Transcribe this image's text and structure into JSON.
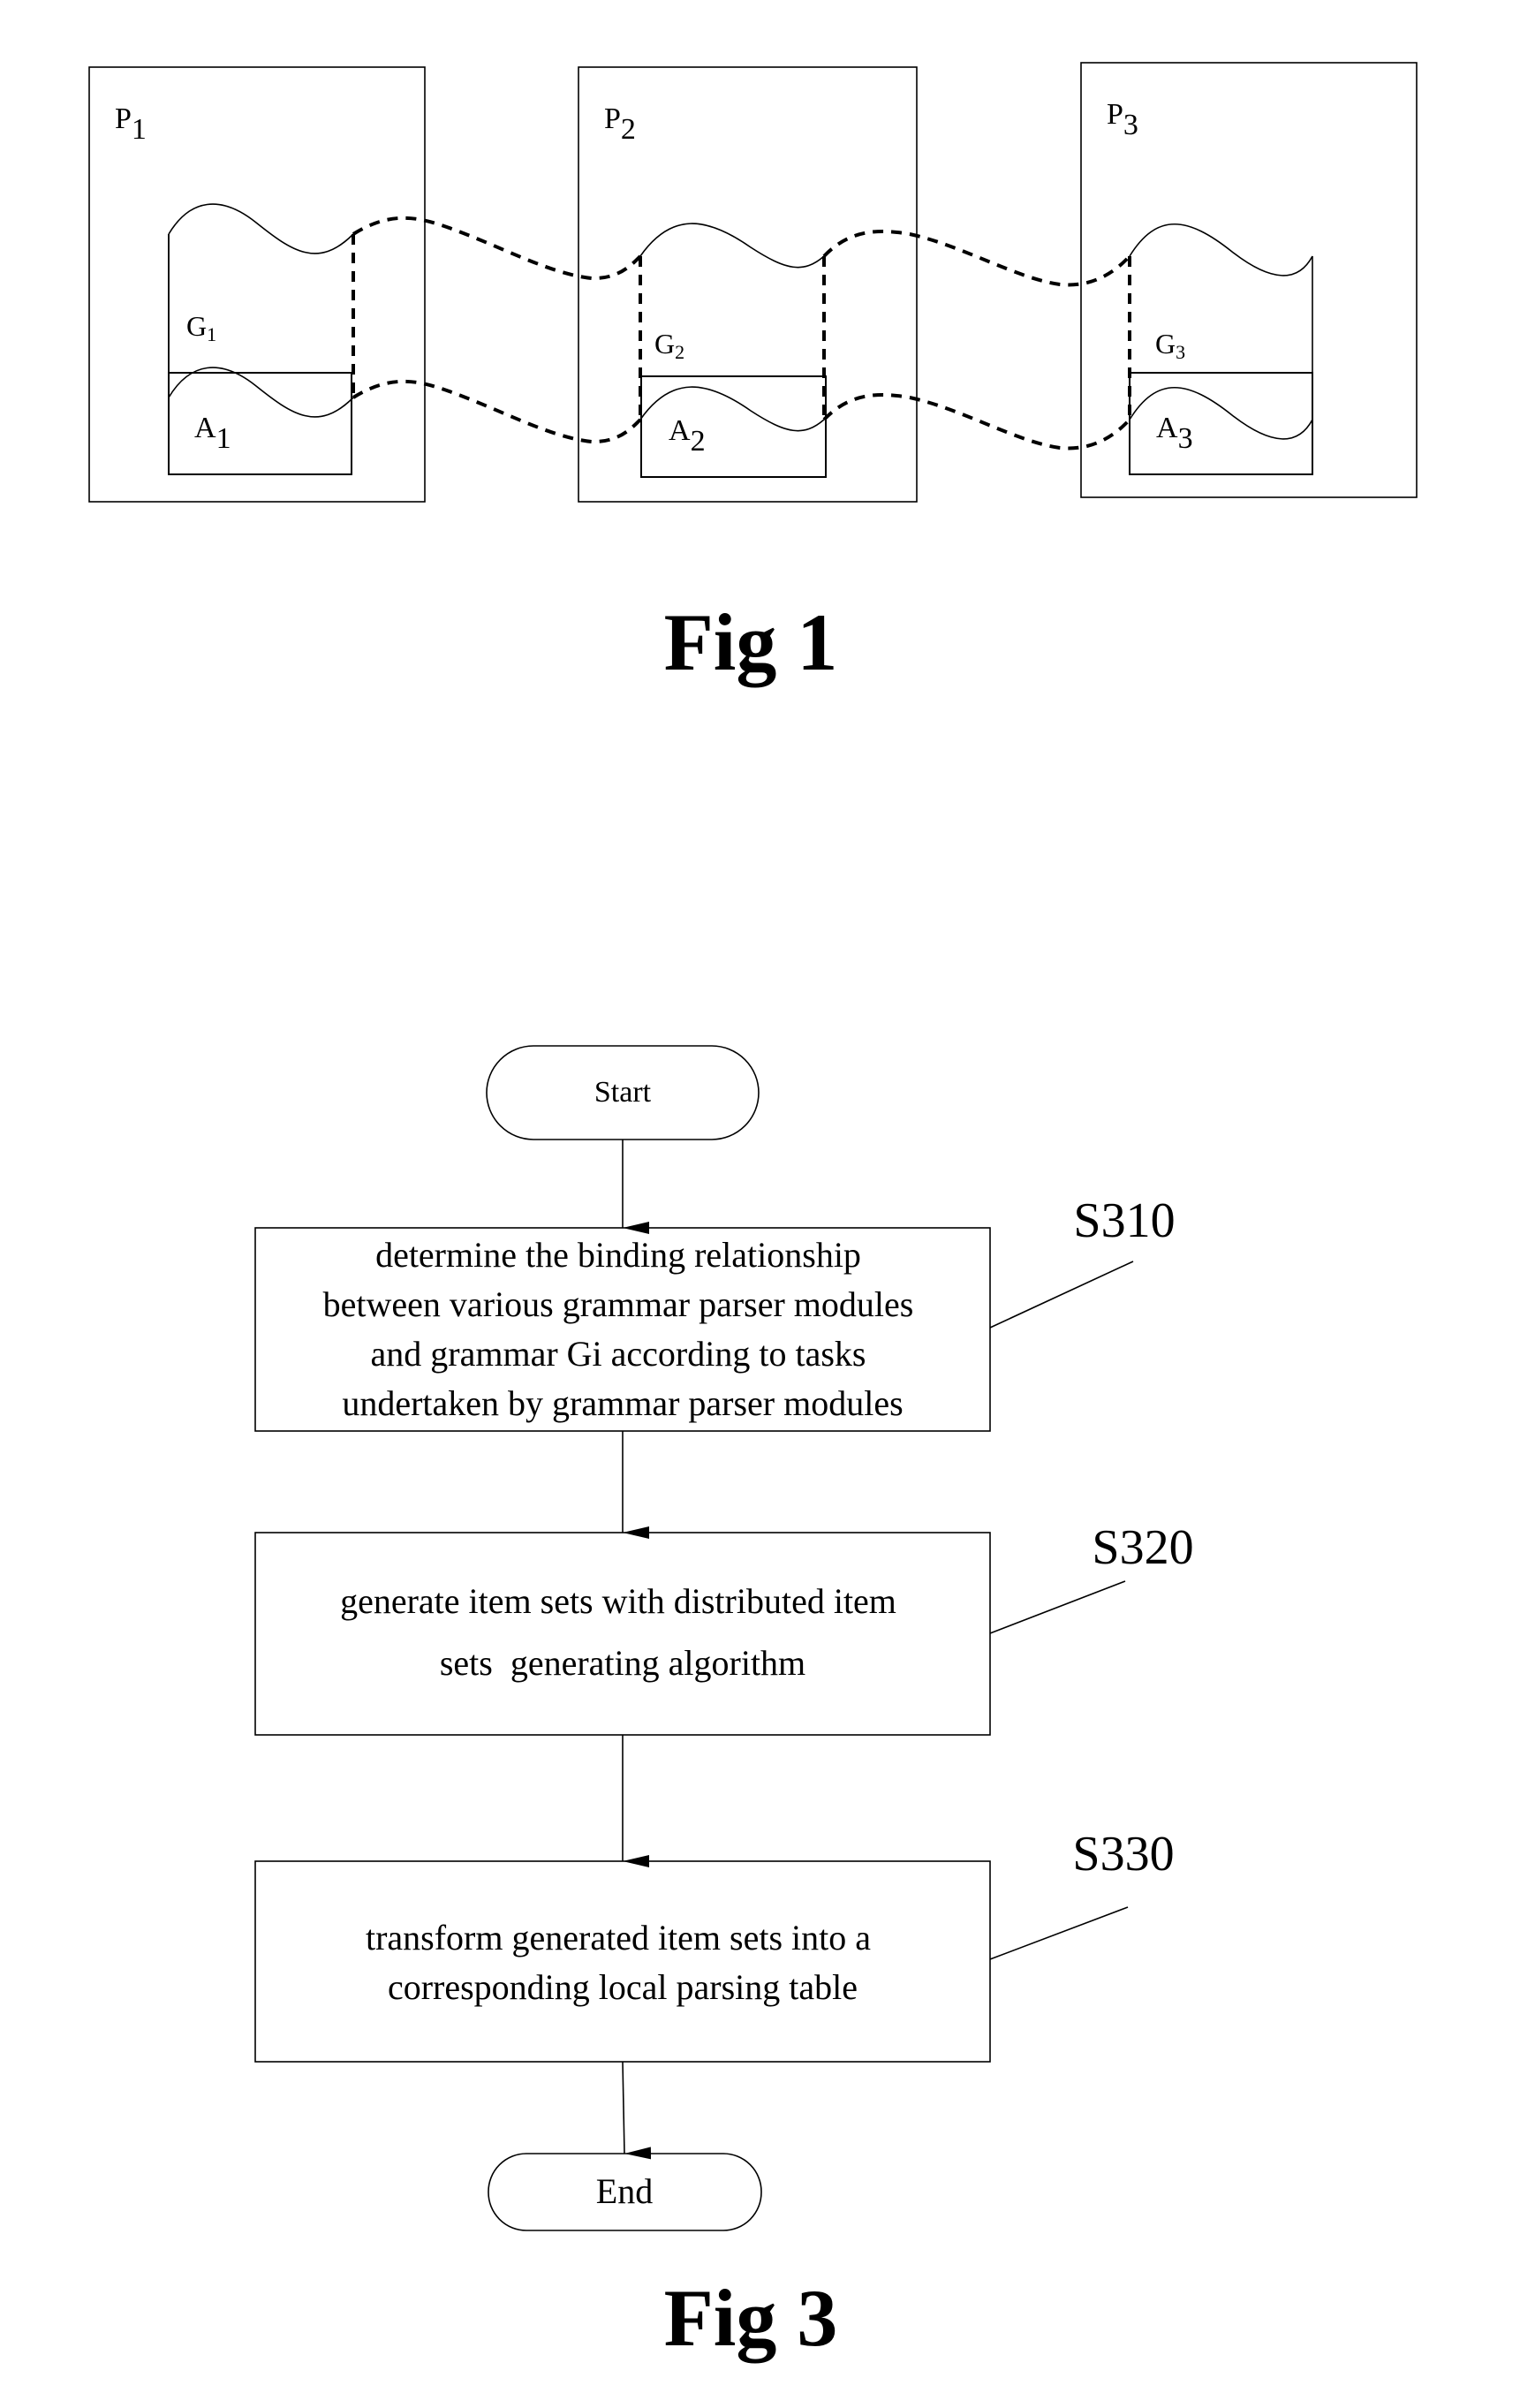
{
  "fig1": {
    "caption": "Fig 1",
    "processors": [
      {
        "label": "P",
        "sub": "1",
        "grammar": "G",
        "grammar_sub": "1",
        "agent": "A",
        "agent_sub": "1"
      },
      {
        "label": "P",
        "sub": "2",
        "grammar": "G",
        "grammar_sub": "2",
        "agent": "A",
        "agent_sub": "2"
      },
      {
        "label": "P",
        "sub": "3",
        "grammar": "G",
        "grammar_sub": "3",
        "agent": "A",
        "agent_sub": "3"
      }
    ]
  },
  "fig3": {
    "caption": "Fig 3",
    "start": "Start",
    "end": "End",
    "steps": [
      {
        "id": "S310",
        "lines": [
          "determine the binding relationship",
          "between various grammar parser modules",
          "and grammar Gi according to tasks",
          "undertaken by grammar parser modules"
        ]
      },
      {
        "id": "S320",
        "lines": [
          "generate item sets with distributed item",
          "sets  generating algorithm"
        ]
      },
      {
        "id": "S330",
        "lines": [
          "transform generated item sets into a",
          "corresponding local parsing table"
        ]
      }
    ]
  }
}
